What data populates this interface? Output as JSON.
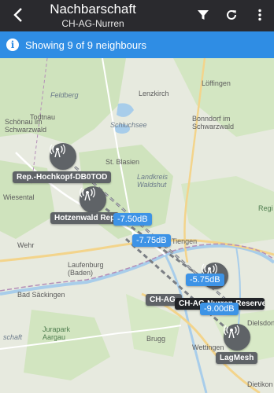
{
  "appbar": {
    "title": "Nachbarschaft",
    "subtitle": "CH-AG-Nurren"
  },
  "info": {
    "text": "Showing 9 of 9 neighbours"
  },
  "map": {
    "places": {
      "todtnau": "Todtnau",
      "lenzkirch": "Lenzkirch",
      "loeffingen": "Löffingen",
      "schoenau": "Schönau im Schwarzwald",
      "feldberg": "Feldberg",
      "schluchsee": "Schluchsee",
      "st_blasien": "St. Blasien",
      "bonndorf": "Bonndorf im Schwarzwald",
      "landkreis": "Landkreis Waldshut",
      "wiesental": "Wiesental",
      "wehr": "Wehr",
      "tiengen": "Tiengen",
      "laufenburg": "Laufenburg (Baden)",
      "bad_saeckingen": "Bad Säckingen",
      "jurapark": "Jurapark Aargau",
      "brugg": "Brugg",
      "wettingen": "Wettingen",
      "dietikon": "Dietikon",
      "dielsdorf": "Dielsdorf",
      "schaft": "schaft",
      "regi": "Regi"
    },
    "nodes": {
      "hochkopf": "Rep.-Hochkopf-DB0TOD",
      "hotzenwald": "Hotzenwald Rep",
      "ch_ag_a": "CH-AG",
      "ch_ag_b": "CH-AG-Nurren-Reserve",
      "lagmesh": "LagMesh"
    },
    "links": {
      "l1": "-7.50dB",
      "l2": "-7.75dB",
      "l3": "-5.75dB",
      "l4": "-9.00dB"
    }
  }
}
